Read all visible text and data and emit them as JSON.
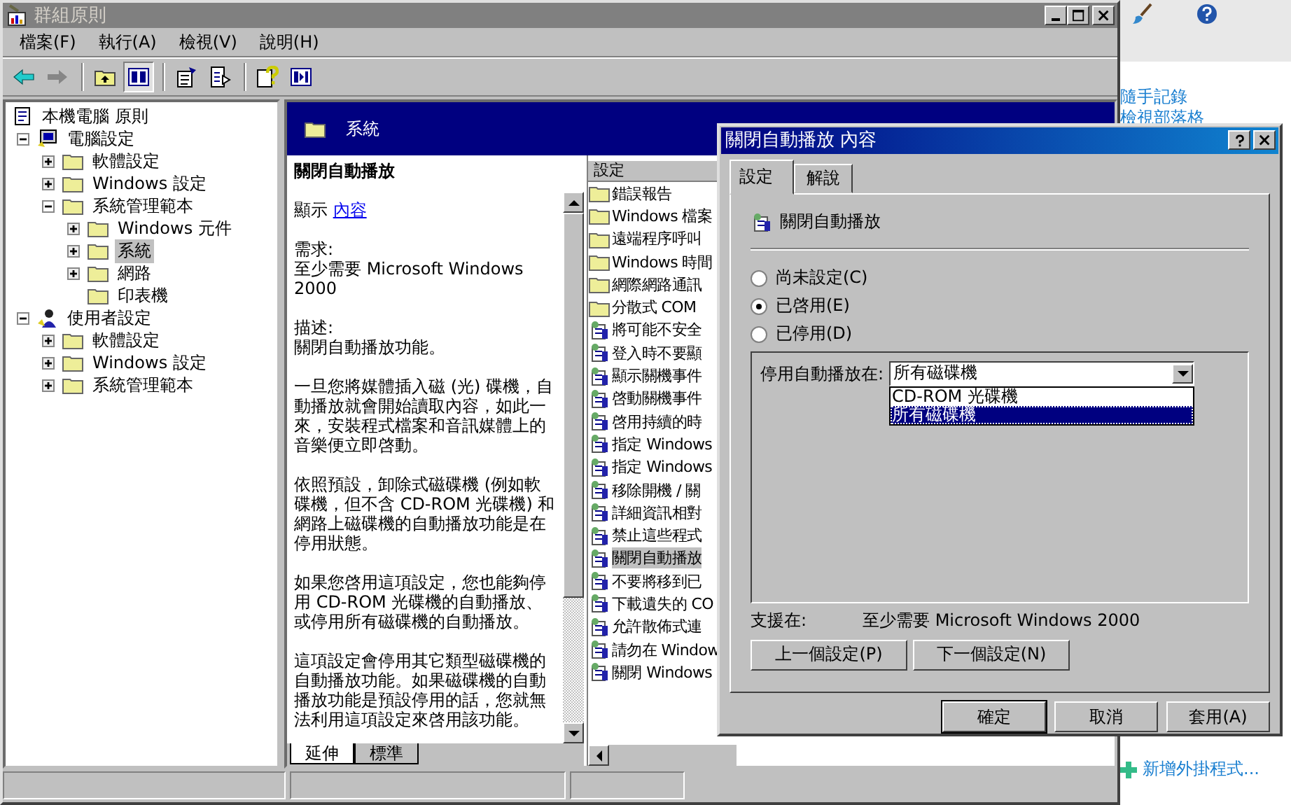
{
  "window": {
    "title": "群組原則"
  },
  "menu": [
    {
      "label": "檔案(F)"
    },
    {
      "label": "執行(A)"
    },
    {
      "label": "檢視(V)"
    },
    {
      "label": "說明(H)"
    }
  ],
  "toolbar": [
    {
      "buttons": [
        {
          "kind": "back",
          "disabled": false,
          "pressed": false
        },
        {
          "kind": "forward",
          "disabled": true,
          "pressed": false
        }
      ]
    },
    {
      "buttons": [
        {
          "kind": "up",
          "disabled": false,
          "pressed": false
        },
        {
          "kind": "tree",
          "disabled": false,
          "pressed": true
        }
      ]
    },
    {
      "buttons": [
        {
          "kind": "properties",
          "disabled": false,
          "pressed": false
        },
        {
          "kind": "export",
          "disabled": false,
          "pressed": false
        }
      ]
    },
    {
      "buttons": [
        {
          "kind": "help",
          "disabled": false,
          "pressed": false
        },
        {
          "kind": "pane",
          "disabled": false,
          "pressed": false
        }
      ]
    }
  ],
  "tree": {
    "items": [
      {
        "label": "本機電腦 原則",
        "kind": "policy",
        "expandable": false,
        "selected": false,
        "children": [
          {
            "label": "電腦設定",
            "kind": "computer",
            "expandable": true,
            "expanded": true,
            "selected": false,
            "children": [
              {
                "label": "軟體設定",
                "kind": "folder",
                "expandable": true,
                "expanded": false,
                "selected": false
              },
              {
                "label": "Windows 設定",
                "kind": "folder",
                "expandable": true,
                "expanded": false,
                "selected": false
              },
              {
                "label": "系統管理範本",
                "kind": "folder",
                "expandable": true,
                "expanded": true,
                "selected": false,
                "children": [
                  {
                    "label": "Windows 元件",
                    "kind": "folder",
                    "expandable": true,
                    "expanded": false,
                    "selected": false
                  },
                  {
                    "label": "系統",
                    "kind": "folder",
                    "expandable": true,
                    "expanded": false,
                    "selected": true
                  },
                  {
                    "label": "網路",
                    "kind": "folder",
                    "expandable": true,
                    "expanded": false,
                    "selected": false
                  },
                  {
                    "label": "印表機",
                    "kind": "folder",
                    "expandable": false,
                    "selected": false
                  }
                ]
              }
            ]
          },
          {
            "label": "使用者設定",
            "kind": "user",
            "expandable": true,
            "expanded": true,
            "selected": false,
            "children": [
              {
                "label": "軟體設定",
                "kind": "folder",
                "expandable": true,
                "expanded": false,
                "selected": false
              },
              {
                "label": "Windows 設定",
                "kind": "folder",
                "expandable": true,
                "expanded": false,
                "selected": false
              },
              {
                "label": "系統管理範本",
                "kind": "folder",
                "expandable": true,
                "expanded": false,
                "selected": false
              }
            ]
          }
        ]
      }
    ]
  },
  "details": {
    "header": "系統",
    "title": "關閉自動播放",
    "show_label": "顯示",
    "show_link": "內容",
    "requirement": {
      "label": "需求:",
      "text": "至少需要 Microsoft Windows 2000"
    },
    "description": {
      "label": "描述:",
      "text": "關閉自動播放功能。"
    },
    "paragraphs": [
      "一旦您將媒體插入磁 (光) 碟機，自動播放就會開始讀取內容，如此一來，安裝程式檔案和音訊媒體上的音樂便立即啓動。",
      "依照預設，卸除式磁碟機 (例如軟碟機，但不含 CD-ROM 光碟機) 和網路上磁碟機的自動播放功能是在停用狀態。",
      "如果您啓用這項設定，您也能夠停用 CD-ROM 光碟機的自動播放、或停用所有磁碟機的自動播放。",
      "這項設定會停用其它類型磁碟機的自動播放功能。如果磁碟機的自動播放功能是預設停用的話，您就無法利用這項設定來啓用該功能。"
    ]
  },
  "list": {
    "column": "設定",
    "items": [
      {
        "label": "錯誤報告",
        "kind": "folder",
        "selected": false
      },
      {
        "label": "Windows 檔案",
        "kind": "folder",
        "selected": false
      },
      {
        "label": "遠端程序呼叫",
        "kind": "folder",
        "selected": false
      },
      {
        "label": "Windows 時間",
        "kind": "folder",
        "selected": false
      },
      {
        "label": "網際網路通訊",
        "kind": "folder",
        "selected": false
      },
      {
        "label": "分散式 COM",
        "kind": "folder",
        "selected": false
      },
      {
        "label": "將可能不安全",
        "kind": "setting",
        "selected": false
      },
      {
        "label": "登入時不要顯",
        "kind": "setting",
        "selected": false
      },
      {
        "label": "顯示關機事件",
        "kind": "setting",
        "selected": false
      },
      {
        "label": "啓動關機事件",
        "kind": "setting",
        "selected": false
      },
      {
        "label": "啓用持續的時",
        "kind": "setting",
        "selected": false
      },
      {
        "label": "指定 Windows",
        "kind": "setting",
        "selected": false
      },
      {
        "label": "指定 Windows",
        "kind": "setting",
        "selected": false
      },
      {
        "label": "移除開機 / 關",
        "kind": "setting",
        "selected": false
      },
      {
        "label": "詳細資訊相對",
        "kind": "setting",
        "selected": false
      },
      {
        "label": "禁止這些程式",
        "kind": "setting",
        "selected": false
      },
      {
        "label": "關閉自動播放",
        "kind": "setting",
        "selected": true
      },
      {
        "label": "不要將移到已",
        "kind": "setting",
        "selected": false
      },
      {
        "label": "下載遺失的 CO",
        "kind": "setting",
        "selected": false
      },
      {
        "label": "允許散佈式連",
        "kind": "setting",
        "selected": false
      },
      {
        "label": "請勿在 Window",
        "kind": "setting",
        "selected": false
      },
      {
        "label": "關閉 Windows",
        "kind": "setting",
        "selected": false
      }
    ]
  },
  "bottom_tabs": [
    {
      "label": "延伸",
      "selected": true
    },
    {
      "label": "標準",
      "selected": false
    }
  ],
  "dialog": {
    "title": "關閉自動播放 內容",
    "tabs": [
      {
        "label": "設定",
        "selected": true
      },
      {
        "label": "解說",
        "selected": false
      }
    ],
    "policy": "關閉自動播放",
    "options": [
      {
        "label": "尚未設定(C)",
        "selected": false
      },
      {
        "label": "已啓用(E)",
        "selected": true
      },
      {
        "label": "已停用(D)",
        "selected": false
      }
    ],
    "dropdown": {
      "label": "停用自動播放在:",
      "value": "所有磁碟機",
      "expanded": true,
      "choices": [
        {
          "label": "CD-ROM 光碟機",
          "selected": false
        },
        {
          "label": "所有磁碟機",
          "selected": true
        }
      ]
    },
    "supported_label": "支援在:",
    "supported_value": "至少需要 Microsoft Windows 2000",
    "nav_buttons": [
      "上一個設定(P)",
      "下一個設定(N)"
    ],
    "buttons": [
      {
        "label": "確定",
        "default": true
      },
      {
        "label": "取消",
        "default": false
      },
      {
        "label": "套用(A)",
        "default": false
      }
    ]
  },
  "side_panel": {
    "links": [
      "隨手記錄",
      "檢視部落格"
    ],
    "add_link": "新增外掛程式..."
  }
}
